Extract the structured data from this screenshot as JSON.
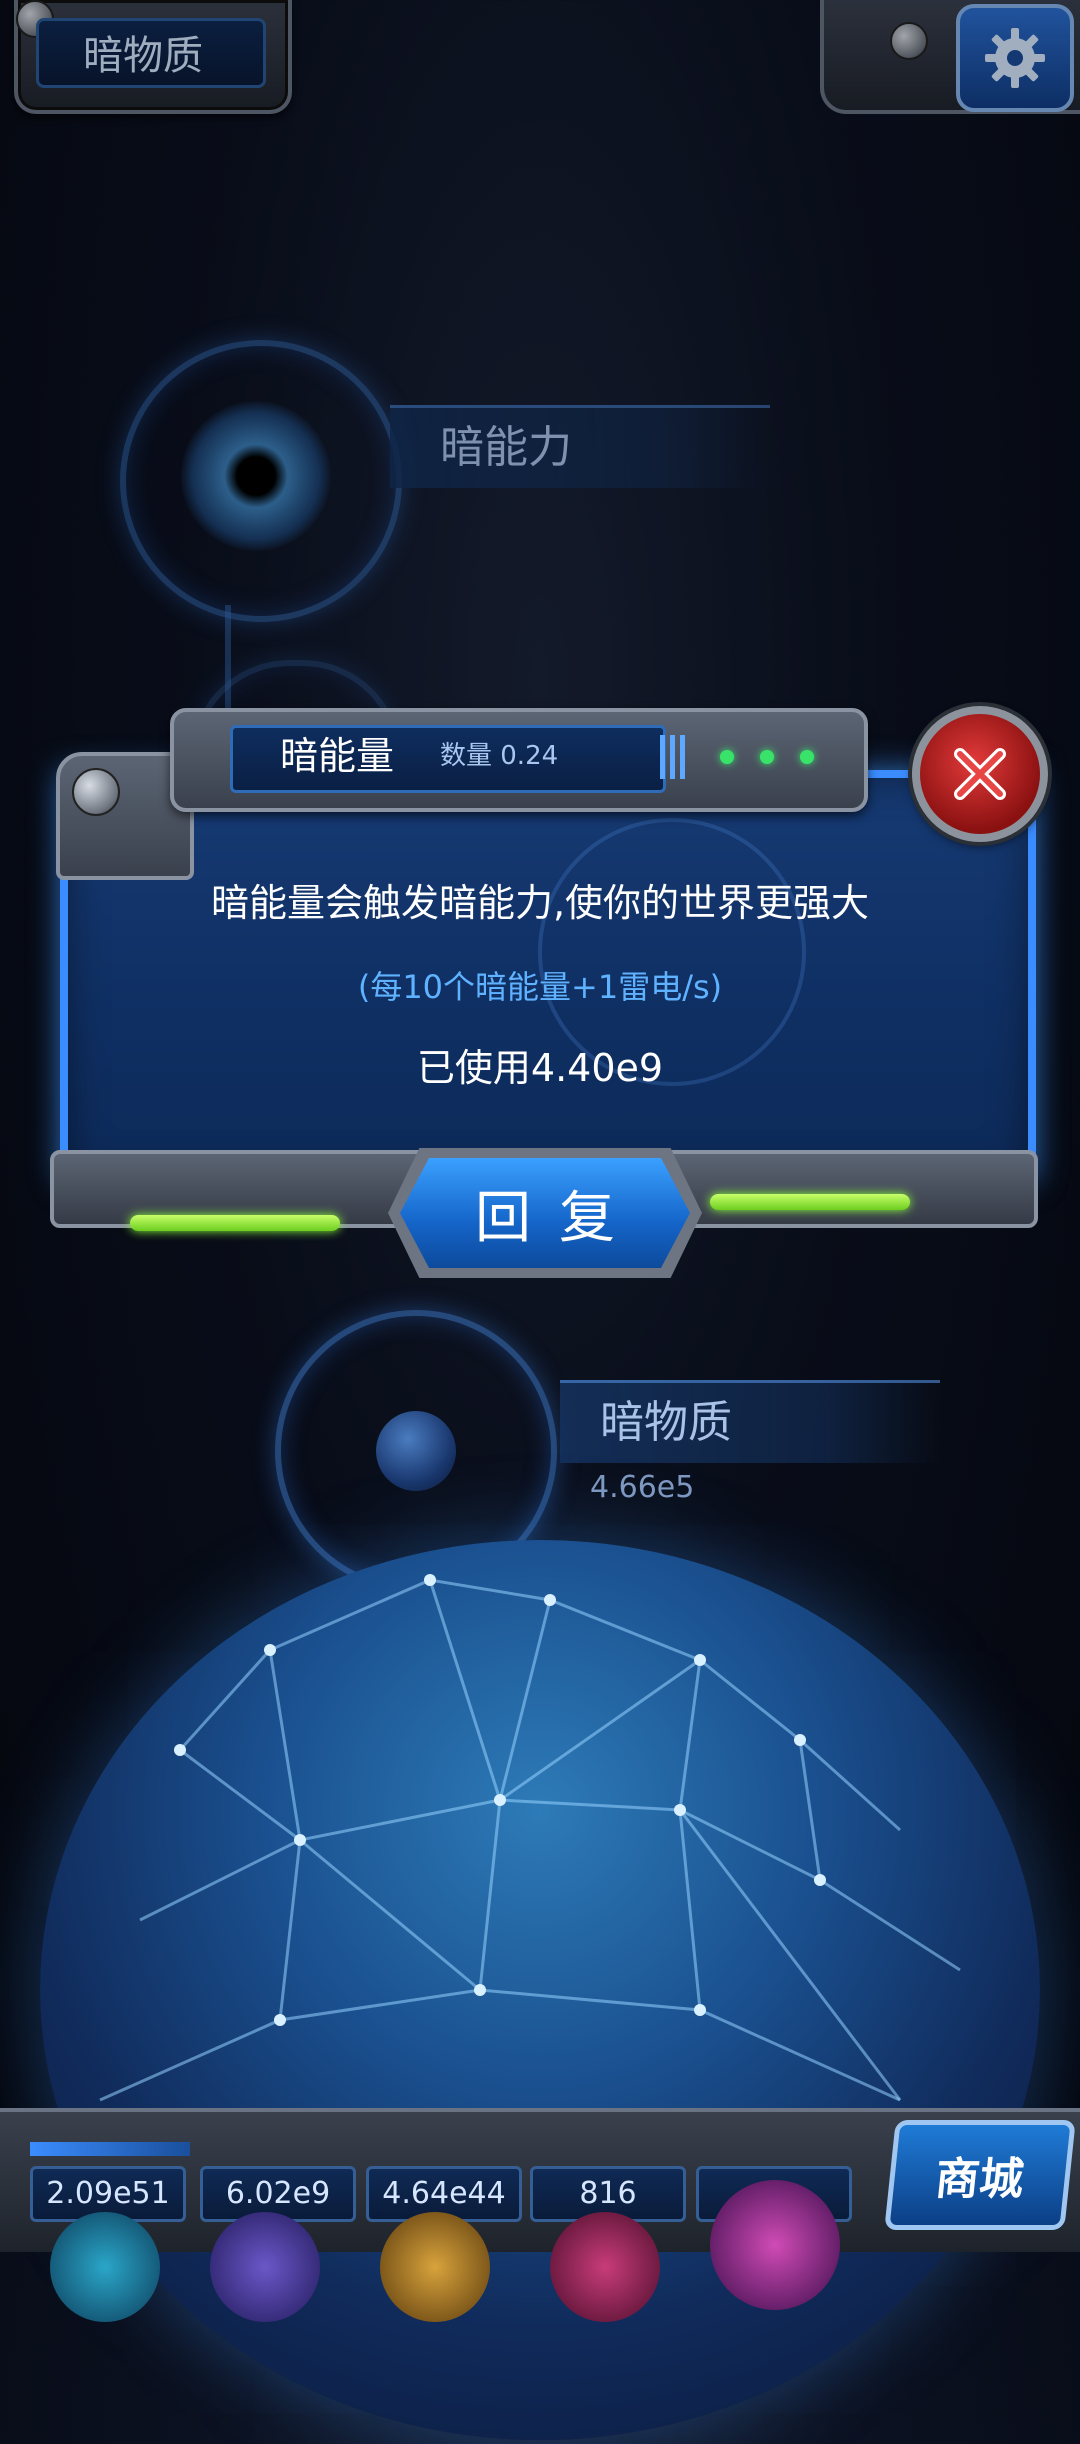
{
  "header": {
    "section_title": "暗物质",
    "settings_icon": "gear-icon"
  },
  "nodes": {
    "dark_ability": {
      "label": "暗能力"
    },
    "dark_matter": {
      "label": "暗物质",
      "value": "4.66e5"
    }
  },
  "modal": {
    "title": "暗能量",
    "count": "数量 0.24",
    "description": "暗能量会触发暗能力,使你的世界更强大",
    "effect": "(每10个暗能量+1雷电/s)",
    "used": "已使用4.40e9",
    "restore_label": "回复",
    "close_icon": "close-icon"
  },
  "resources": [
    "2.09e51",
    "6.02e9",
    "4.64e44",
    "816"
  ],
  "shop_label": "商城",
  "colors": {
    "accent_blue": "#3b8cff",
    "effect_text": "#5fb2ff",
    "close_red": "#d32626",
    "energy_green": "#8bff3a"
  }
}
